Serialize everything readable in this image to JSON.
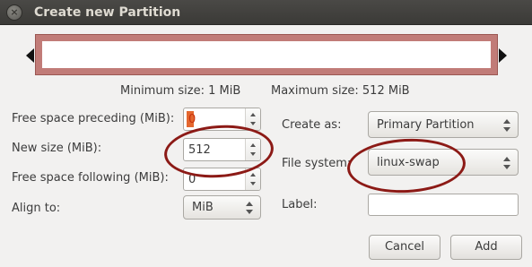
{
  "window": {
    "title": "Create new Partition",
    "close_glyph": "×"
  },
  "partition_visual": {
    "fill_color": "#c17c78",
    "inner_color": "#ffffff"
  },
  "size_info": {
    "minimum": "Minimum size: 1 MiB",
    "maximum": "Maximum size: 512 MiB"
  },
  "form": {
    "free_preceding": {
      "label": "Free space preceding (MiB):",
      "value": "0"
    },
    "new_size": {
      "label": "New size (MiB):",
      "value": "512"
    },
    "free_following": {
      "label": "Free space following (MiB):",
      "value": "0"
    },
    "align_to": {
      "label": "Align to:",
      "value": "MiB"
    },
    "create_as": {
      "label": "Create as:",
      "value": "Primary Partition"
    },
    "file_system": {
      "label": "File system:",
      "value": "linux-swap"
    },
    "partition_label": {
      "label": "Label:",
      "value": ""
    }
  },
  "buttons": {
    "cancel": "Cancel",
    "add": "Add"
  },
  "annotation_color": "#8c1a16"
}
